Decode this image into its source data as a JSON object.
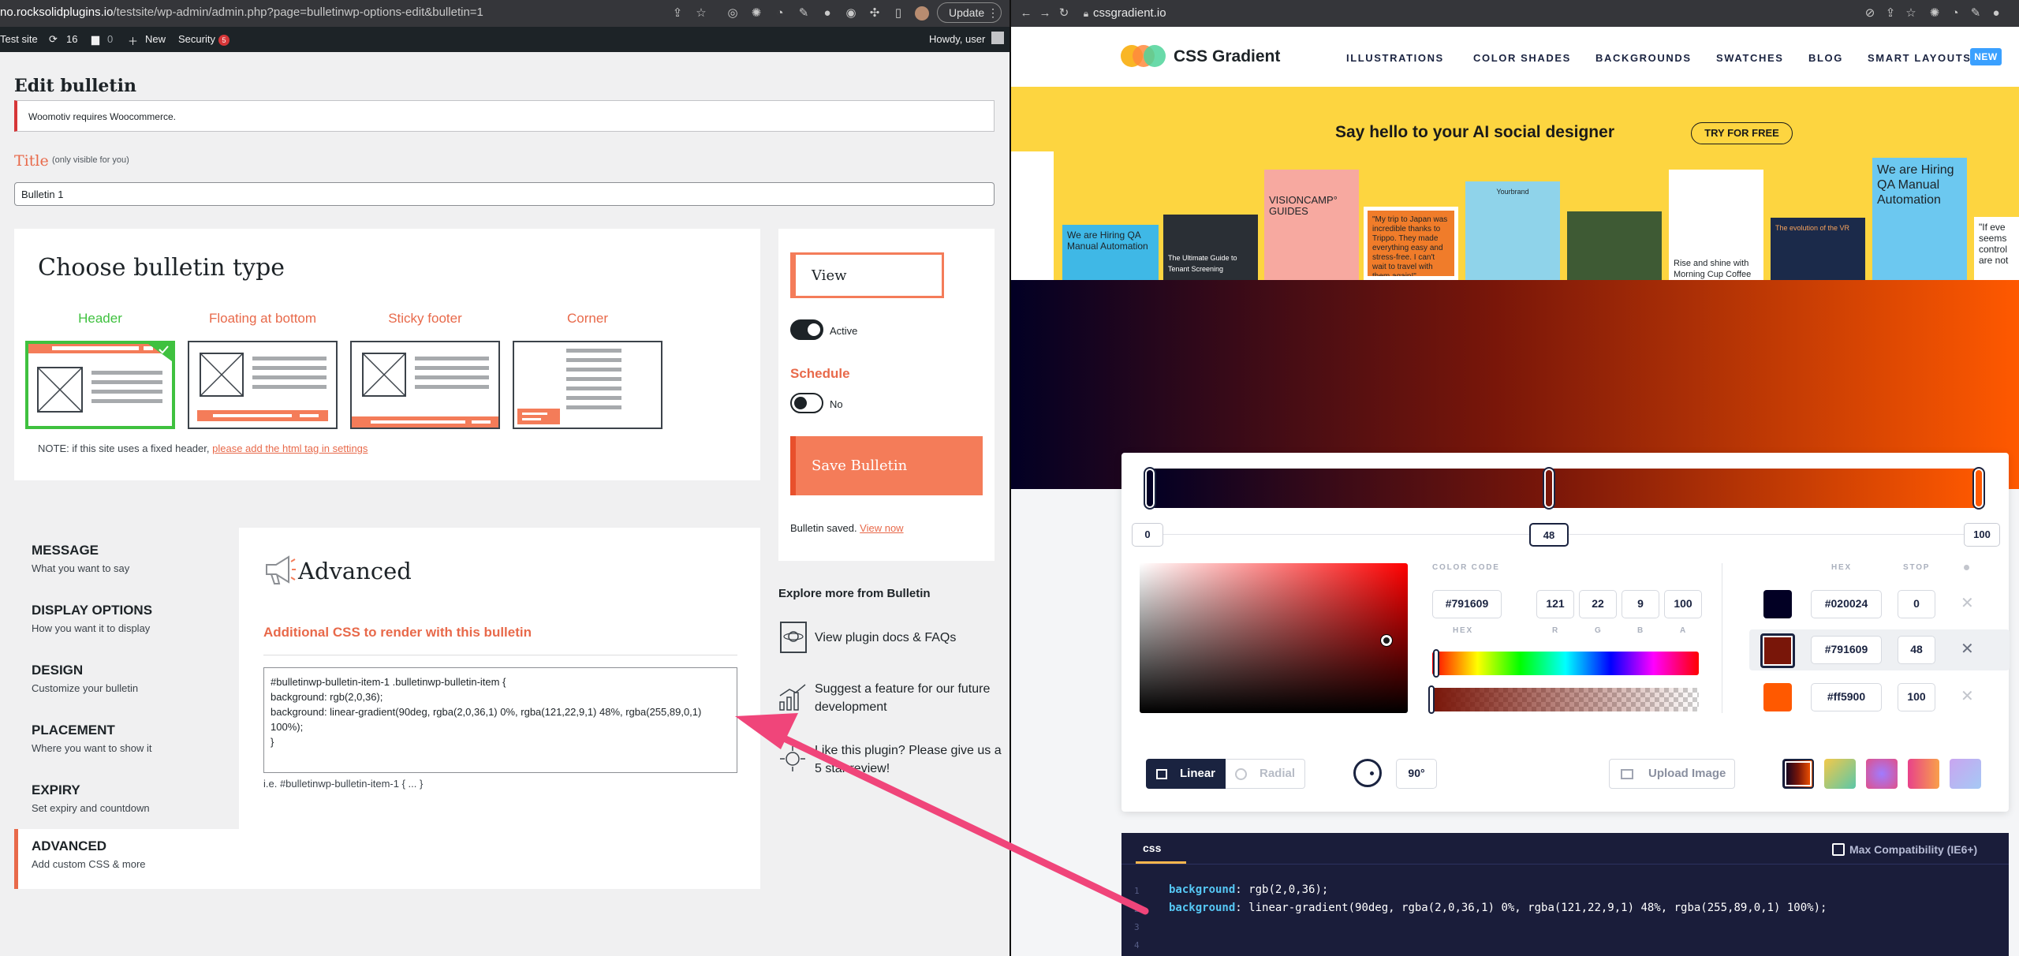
{
  "left_browser": {
    "url_host": "no.rocksolidplugins.io",
    "url_path": "/testsite/wp-admin/admin.php?page=bulletinwp-options-edit&bulletin=1",
    "update_label": "Update"
  },
  "admin_bar": {
    "site": "Test site",
    "updates": "16",
    "comments": "0",
    "new": "New",
    "security": "Security",
    "security_count": "5",
    "howdy": "Howdy, user"
  },
  "edit": {
    "page_title": "Edit bulletin",
    "notice": "Woomotiv requires Woocommerce.",
    "title_label": "Title",
    "title_sub": "(only visible for you)",
    "title_value": "Bulletin 1"
  },
  "choose": {
    "heading": "Choose bulletin type",
    "types": [
      {
        "label": "Header",
        "color": "#3fc13f"
      },
      {
        "label": "Floating at bottom",
        "color": "#e8694a"
      },
      {
        "label": "Sticky footer",
        "color": "#e8694a"
      },
      {
        "label": "Corner",
        "color": "#e8694a"
      }
    ],
    "note_prefix": "NOTE: if this site uses a fixed header, ",
    "note_link": "please add the html tag in settings"
  },
  "sidebar_right": {
    "view": "View",
    "active": "Active",
    "schedule": "Schedule",
    "schedule_value": "No",
    "save": "Save Bulletin",
    "saved_prefix": "Bulletin saved. ",
    "saved_link": "View now"
  },
  "menu": [
    {
      "title": "MESSAGE",
      "sub": "What you want to say"
    },
    {
      "title": "DISPLAY OPTIONS",
      "sub": "How you want it to display"
    },
    {
      "title": "DESIGN",
      "sub": "Customize your bulletin"
    },
    {
      "title": "PLACEMENT",
      "sub": "Where you want to show it"
    },
    {
      "title": "EXPIRY",
      "sub": "Set expiry and countdown"
    },
    {
      "title": "ADVANCED",
      "sub": "Add custom CSS & more"
    }
  ],
  "advanced": {
    "heading": "Advanced",
    "css_label": "Additional CSS to render with this bulletin",
    "css_lines": [
      "#bulletinwp-bulletin-item-1 .bulletinwp-bulletin-item {",
      "background: rgb(2,0,36);",
      "background: linear-gradient(90deg, rgba(2,0,36,1) 0%, rgba(121,22,9,1) 48%, rgba(255,89,0,1)",
      "100%);",
      "}"
    ],
    "example": "i.e. #bulletinwp-bulletin-item-1 { ... }"
  },
  "explore": {
    "title": "Explore more from Bulletin",
    "items": [
      "View plugin docs & FAQs",
      "Suggest a feature for our future development",
      "Like this plugin? Please give us a 5 star review!"
    ]
  },
  "right_browser": {
    "url": "cssgradient.io"
  },
  "site": {
    "logo": "CSS Gradient",
    "nav": [
      "ILLUSTRATIONS",
      "COLOR SHADES",
      "BACKGROUNDS",
      "SWATCHES",
      "BLOG",
      "SMART LAYOUTS"
    ],
    "new_badge": "NEW",
    "banner_title": "Say hello to your AI social designer",
    "banner_button": "TRY FOR FREE",
    "cards": [
      "We are Hiring QA Manual Automation",
      "The Ultimate Guide to Tenant Screening",
      "VISIONCAMP° GUIDES",
      "\"My trip to Japan was incredible thanks to Trippo. They made everything easy and stress-free. I can't wait to travel with them again!\"",
      "Yourbrand",
      "Rise and shine with Morning Cup Coffee",
      "The evolution of the VR",
      "We are Hiring QA Manual Automation",
      "\"If eve seems control are not"
    ]
  },
  "gradient_tool": {
    "stops_labels": [
      "0",
      "48",
      "100"
    ],
    "color_code_label": "COLOR CODE",
    "hex_value": "#791609",
    "hex_label": "HEX",
    "r": "121",
    "g": "22",
    "b": "9",
    "a": "100",
    "r_label": "R",
    "g_label": "G",
    "b_label": "B",
    "a_label": "A",
    "col_hex": "HEX",
    "col_stop": "STOP",
    "stops": [
      {
        "hex": "#020024",
        "stop": "0",
        "color": "#020024"
      },
      {
        "hex": "#791609",
        "stop": "48",
        "color": "#791609"
      },
      {
        "hex": "#ff5900",
        "stop": "100",
        "color": "#ff5900"
      }
    ],
    "linear": "Linear",
    "radial": "Radial",
    "angle": "90°",
    "upload": "Upload Image"
  },
  "code": {
    "tab": "css",
    "max_compat": "Max Compatibility (IE6+)",
    "line1_prop": "background",
    "line1_val": ": rgb(2,0,36);",
    "line2_prop": "background",
    "line2_val": ": linear-gradient(90deg, rgba(2,0,36,1) 0%, rgba(121,22,9,1) 48%, rgba(255,89,0,1) 100%);",
    "line_numbers": [
      "1",
      "2",
      "3",
      "4"
    ]
  },
  "colors": {
    "accent_orange": "#e8694a",
    "header_green": "#3fc13f",
    "gradient_start": "#020024",
    "gradient_mid": "#791609",
    "gradient_end": "#ff5900",
    "arrow": "#f0457a"
  }
}
